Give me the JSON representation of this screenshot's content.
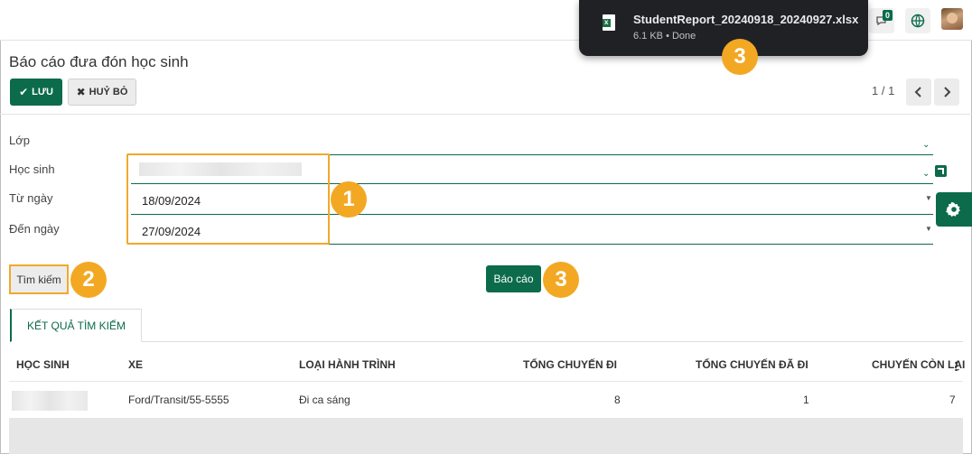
{
  "header": {
    "chat_count": "0",
    "icons": [
      "chat-icon",
      "globe-icon",
      "avatar"
    ]
  },
  "download": {
    "filename": "StudentReport_20240918_20240927.xlsx",
    "meta": "6.1 KB • Done",
    "icon": "excel-file-icon"
  },
  "page": {
    "title": "Báo cáo đưa đón học sinh"
  },
  "toolbar": {
    "save_label": "LƯU",
    "cancel_label": "HUỶ BỎ",
    "pager": "1 / 1"
  },
  "form": {
    "class_label": "Lớp",
    "class_value": "",
    "student_label": "Học sinh",
    "from_label": "Từ ngày",
    "from_value": "18/09/2024",
    "to_label": "Đến ngày",
    "to_value": "27/09/2024"
  },
  "actions": {
    "search_label": "Tìm kiếm",
    "report_label": "Báo cáo"
  },
  "markers": {
    "m1": "1",
    "m2": "2",
    "m3_report": "3",
    "m3_download": "3"
  },
  "results": {
    "tab_label": "KẾT QUẢ TÌM KIẾM",
    "columns": [
      "HỌC SINH",
      "XE",
      "LOẠI HÀNH TRÌNH",
      "TỔNG CHUYẾN ĐI",
      "TỔNG CHUYẾN ĐÃ ĐI",
      "CHUYẾN CÒN LẠI"
    ],
    "rows": [
      {
        "student": "",
        "vehicle": "Ford/Transit/55-5555",
        "route_type": "Đi ca sáng",
        "total_trips": "8",
        "trips_done": "1",
        "trips_left": "7"
      }
    ]
  },
  "colors": {
    "primary": "#0b6b4a",
    "highlight": "#f0a92b",
    "marker": "#f3a823",
    "toast_bg": "#202124"
  }
}
